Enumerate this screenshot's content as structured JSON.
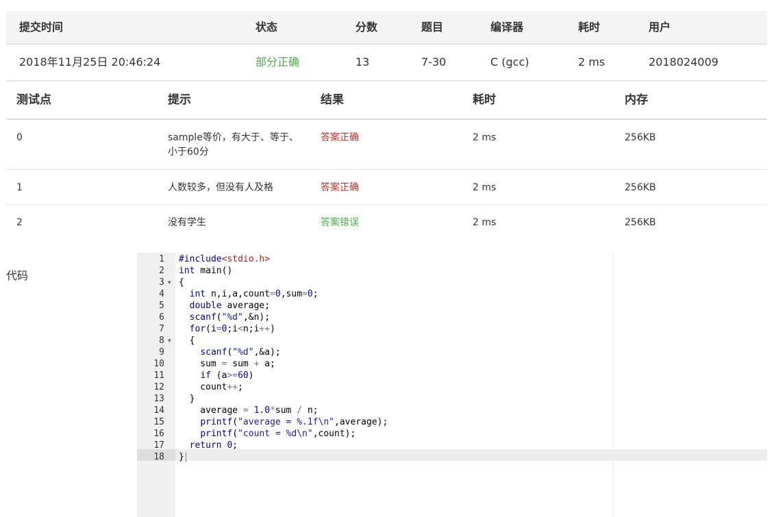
{
  "submission": {
    "headers": [
      "提交时间",
      "状态",
      "分数",
      "题目",
      "编译器",
      "耗时",
      "用户"
    ],
    "time": "2018年11月25日 20:46:24",
    "status": "部分正确",
    "score": "13",
    "problem": "7-30",
    "compiler": "C (gcc)",
    "elapsed": "2 ms",
    "user": "2018024009"
  },
  "tests": {
    "headers": [
      "测试点",
      "提示",
      "结果",
      "耗时",
      "内存"
    ],
    "rows": [
      {
        "id": "0",
        "hint": "sample等价，有大于、等于、小于60分",
        "result": "答案正确",
        "time": "2 ms",
        "memory": "256KB"
      },
      {
        "id": "1",
        "hint": "人数较多，但没有人及格",
        "result": "答案正确",
        "time": "2 ms",
        "memory": "256KB"
      },
      {
        "id": "2",
        "hint": "没有学生",
        "result": "答案错误",
        "time": "2 ms",
        "memory": "256KB"
      }
    ]
  },
  "code_label": "代码",
  "colors": {
    "correct_green": "#4cae4c",
    "wrong_red": "#c9302c"
  },
  "code_lines": [
    "#include<stdio.h>",
    "int main()",
    "{",
    "  int n,i,a,count=0,sum=0;",
    "  double average;",
    "  scanf(\"%d\",&n);",
    "  for(i=0;i<n;i++)",
    "  {",
    "    scanf(\"%d\",&a);",
    "    sum = sum + a;",
    "    if (a>=60)",
    "    count++;",
    "  }",
    "    average = 1.0*sum / n;",
    "    printf(\"average = %.1f\\n\",average);",
    "    printf(\"count = %d\\n\",count);",
    "  return 0;",
    "}"
  ],
  "line_numbers": [
    "1",
    "2",
    "3",
    "4",
    "5",
    "6",
    "7",
    "8",
    "9",
    "10",
    "11",
    "12",
    "13",
    "14",
    "15",
    "16",
    "17",
    "18"
  ]
}
